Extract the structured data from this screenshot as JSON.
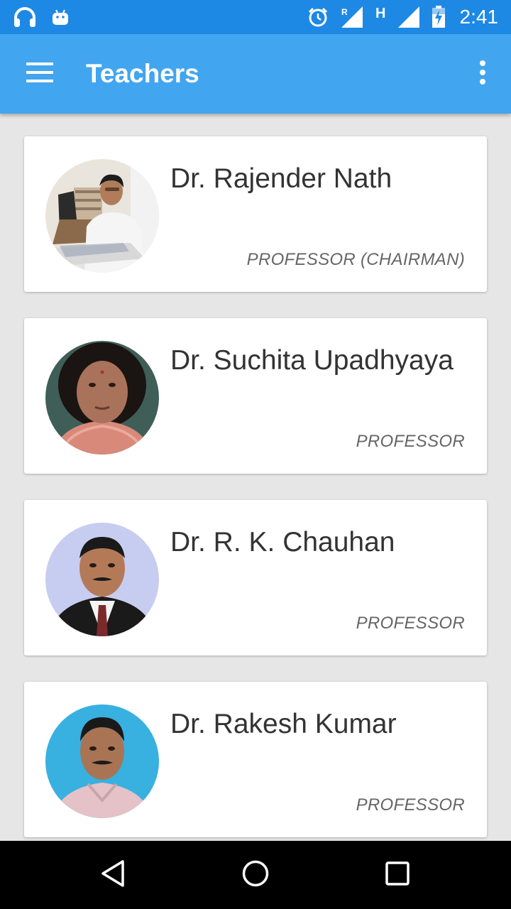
{
  "status_bar": {
    "time": "2:41",
    "network_type": "H",
    "roaming_indicator": "R",
    "icons": [
      "headphones-icon",
      "android-icon",
      "alarm-icon",
      "signal-roaming-icon",
      "signal-icon",
      "battery-charging-icon"
    ]
  },
  "app_bar": {
    "title": "Teachers",
    "menu_icon": "hamburger-menu-icon",
    "overflow_icon": "more-vert-icon"
  },
  "teachers": [
    {
      "name": "Dr. Rajender Nath",
      "designation": "PROFESSOR (CHAIRMAN)"
    },
    {
      "name": "Dr. Suchita Upadhyaya",
      "designation": "PROFESSOR"
    },
    {
      "name": "Dr. R. K. Chauhan",
      "designation": "PROFESSOR"
    },
    {
      "name": "Dr. Rakesh Kumar",
      "designation": "PROFESSOR"
    }
  ],
  "nav_bar": {
    "icons": [
      "back-icon",
      "home-icon",
      "recents-icon"
    ]
  },
  "colors": {
    "status_bar": "#1e88e5",
    "app_bar": "#42a5ef",
    "background": "#e6e6e6",
    "card": "#ffffff",
    "name_text": "#333333",
    "role_text": "#666666"
  }
}
